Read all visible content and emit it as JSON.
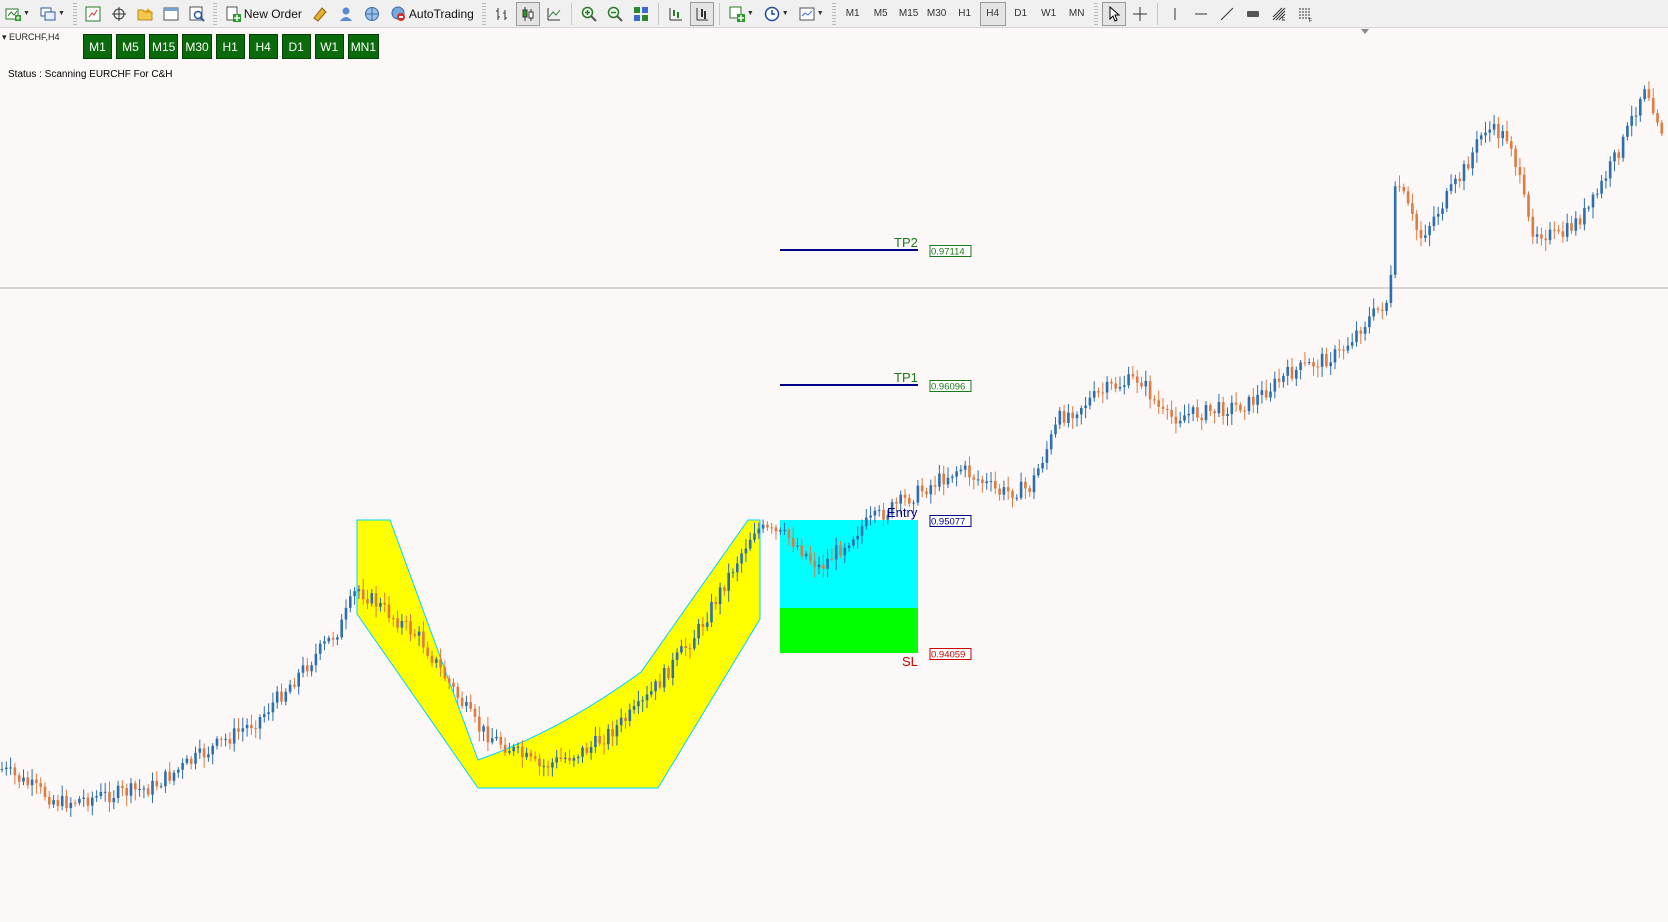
{
  "toolbar": {
    "new_order": "New Order",
    "autotrading": "AutoTrading",
    "timeframes": [
      "M1",
      "M5",
      "M15",
      "M30",
      "H1",
      "H4",
      "D1",
      "W1",
      "MN"
    ],
    "active_timeframe": "H4"
  },
  "chart": {
    "symbol": "EURCHF,H4",
    "tf_buttons": [
      "M1",
      "M5",
      "M15",
      "M30",
      "H1",
      "H4",
      "D1",
      "W1",
      "MN1"
    ],
    "status": "Status : Scanning EURCHF For C&H",
    "colors": {
      "background": "#fcf8f7",
      "bull": "#2b6fb0",
      "bear": "#e07a3f",
      "cup_fill": "#ffff00",
      "cup_stroke": "#00d4ff",
      "target_zone": "#00ffff",
      "stop_zone": "#00ff00",
      "tp_line": "#00008b",
      "tp_label": "#1a7a1a",
      "sl_label": "#cc0000",
      "entry_label": "#00008b"
    },
    "levels": {
      "tp2": {
        "label": "TP2",
        "price": "0.97114"
      },
      "tp1": {
        "label": "TP1",
        "price": "0.96096"
      },
      "entry": {
        "label": "Entry",
        "price": "0.95077"
      },
      "sl": {
        "label": "SL",
        "price": "0.94059"
      }
    }
  }
}
